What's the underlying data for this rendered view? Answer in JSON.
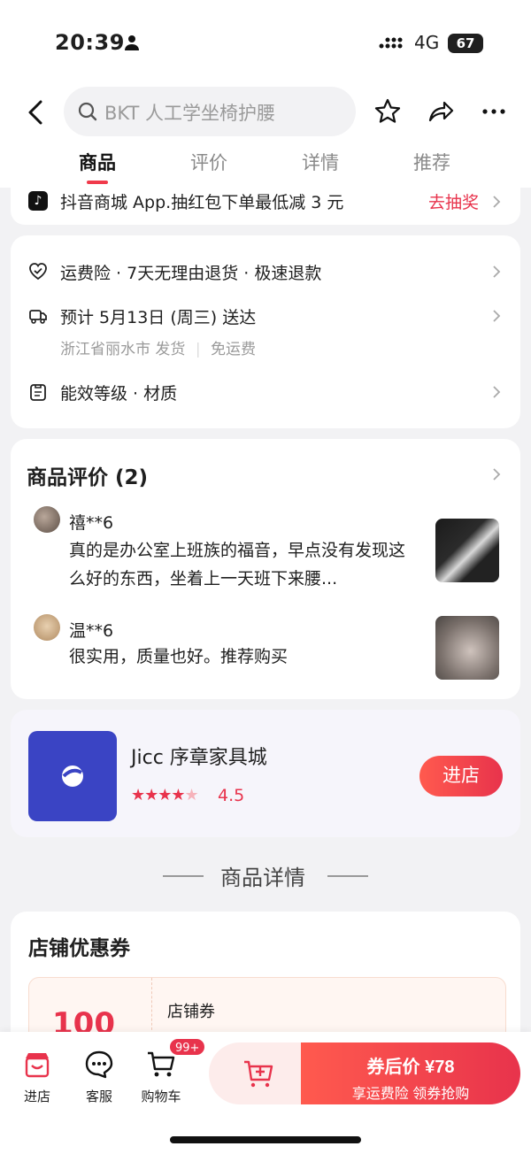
{
  "status": {
    "time": "20:39",
    "network": "4G",
    "battery": "67"
  },
  "header": {
    "search_placeholder": "BKT 人工学坐椅护腰",
    "tabs": [
      "商品",
      "评价",
      "详情",
      "推荐"
    ]
  },
  "promo": {
    "text": "抖音商城 App.抽红包下单最低减 3 元",
    "cta": "去抽奖"
  },
  "services": {
    "guarantees": "运费险 · 7天无理由退货 · 极速退款",
    "delivery": "预计 5月13日 (周三) 送达",
    "shipping_from": "浙江省丽水市 发货",
    "shipping_fee": "免运费",
    "specs": "能效等级 · 材质"
  },
  "reviews": {
    "title": "商品评价 (2)",
    "items": [
      {
        "user": "禧**6",
        "text": "真的是办公室上班族的福音，早点没有发现这么好的东西，坐着上一天班下来腰..."
      },
      {
        "user": "温**6",
        "text": "很实用，质量也好。推荐购买"
      }
    ]
  },
  "shop": {
    "name": "Jicc 序章家具城",
    "rating": "4.5",
    "rating_value": 4.5,
    "enter_label": "进店"
  },
  "section_divider": "商品详情",
  "coupons": {
    "title": "店铺优惠券",
    "amount": "100",
    "coupon_name": "店铺券"
  },
  "bottom_bar": {
    "store": "进店",
    "service": "客服",
    "cart": "购物车",
    "cart_badge": "99+",
    "buy_line1": "券后价 ¥78",
    "buy_line2": "享运费险  领券抢购"
  },
  "colors": {
    "accent": "#e8334c",
    "shop_logo": "#3a44c4"
  }
}
